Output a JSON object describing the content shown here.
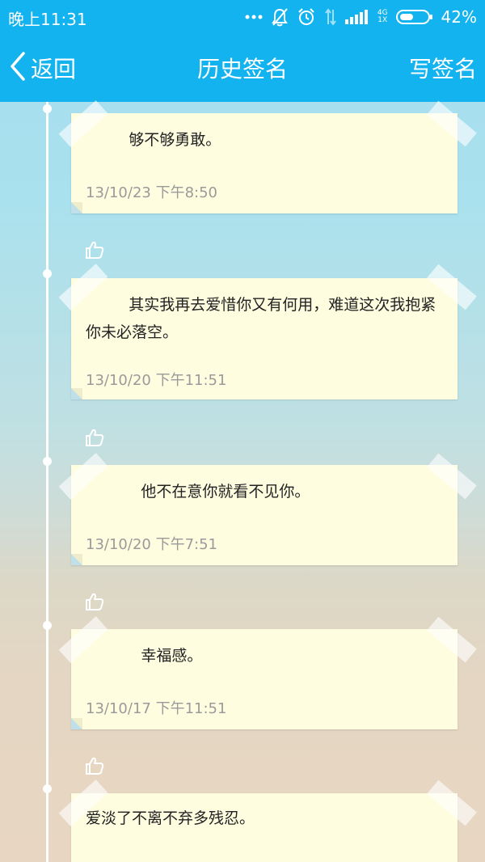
{
  "status_bar": {
    "time": "晚上11:31",
    "network_top": "4G",
    "network_bottom": "1X",
    "battery": "42%"
  },
  "title_bar": {
    "back_label": "返回",
    "title": "历史签名",
    "write_label": "写签名",
    "color": "#12b3ee"
  },
  "signatures": [
    {
      "text": "够不够勇敢。",
      "date": "13/10/23 下午8:50"
    },
    {
      "text": "其实我再去爱惜你又有何用，难道这次我抱紧你未必落空。",
      "date": "13/10/20 下午11:51"
    },
    {
      "text": "他不在意你就看不见你。",
      "date": "13/10/20 下午7:51"
    },
    {
      "text": "幸福感。",
      "date": "13/10/17 下午11:51"
    },
    {
      "text": "爱淡了不离不弃多残忍。",
      "date": ""
    }
  ],
  "icons": {
    "back": "chevron-left-icon",
    "like": "thumbs-up-icon",
    "dnd": "bell-off-icon",
    "alarm": "alarm-clock-icon",
    "data": "data-arrows-icon",
    "signal": "signal-bars-icon",
    "battery": "battery-icon"
  }
}
